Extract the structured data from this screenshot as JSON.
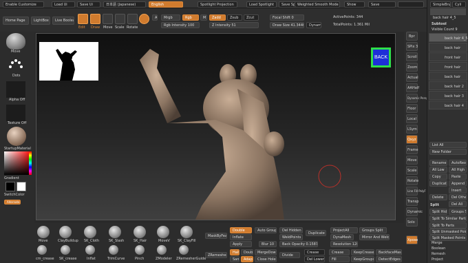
{
  "menu": {
    "enable_customize": "Enable Customize",
    "load_ui": "Load Ui",
    "save_ui": "Save Ui",
    "language_jp": "日本語 (Japanese)",
    "language_en": "English",
    "spotlight_projection": "Spotlight Projection",
    "load_spotlight": "Load Spotlight",
    "save_spotlight": "Save Spotlight",
    "weighted_smooth": "Weighted Smooth Mode 0",
    "show": "Show",
    "save": "Save",
    "simple_brush": "SimpleBrush",
    "cyl": "Cyli"
  },
  "toolbar": {
    "home_page": "Home Page",
    "lightbox": "LightBox",
    "live_boolean": "Live Boolean",
    "edit": "Edit",
    "draw": "Draw",
    "move": "Move",
    "scale": "Scale",
    "rotate": "Rotate",
    "a_label": "A",
    "mrgb": "Mrgb",
    "rgb": "Rgb",
    "m": "M",
    "zadd": "Zadd",
    "zsub": "Zsub",
    "zcut": "Zcut",
    "rgb_intensity": "Rgb Intensity 100",
    "z_intensity": "Z Intensity 51",
    "focal_shift": "Focal Shift 0",
    "draw_size": "Draw Size 41.34402",
    "dynamic": "Dynamic",
    "active_points": "ActivePoints: 344",
    "total_points": "TotalPoints: 1.361 Mil"
  },
  "left_tray": {
    "move_label": "Move",
    "dots_label": "Dots",
    "alpha_off": "Alpha Off",
    "texture_off": "Texture Off",
    "startup_material": "StartupMaterial",
    "gradient": "Gradient",
    "switch_color": "SwitchColor",
    "alternate": "Alternate"
  },
  "canvas": {
    "back_button": "BACK"
  },
  "right_shelf": [
    "Bpr",
    "SPix 3",
    "Scroll",
    "Zoom",
    "Actual",
    "AAHalf",
    "Dynamic Persp",
    "Floor",
    "Local",
    "LSym",
    "Qxyz",
    "Frame",
    "Move",
    "Scale",
    "Rotate",
    "Line Fill PolyF",
    "Transp",
    "Dynamic",
    "Solo",
    "Xpose"
  ],
  "right_tray": {
    "subtool_header": "Subtool",
    "visible_count": "Visible Count 9",
    "current_tool": "back hair 4_5",
    "subtool_items": [
      "back hair 4_5",
      "back hair",
      "front hair",
      "front hair",
      "back hair",
      "back hair 2",
      "back hair 3",
      "back hair 4"
    ],
    "list_all": "List All",
    "new_folder": "New Folder",
    "rename": "Rename",
    "auto_reorder": "AutoReorder",
    "all_low": "All Low",
    "all_high": "All High",
    "copy": "Copy",
    "paste": "Paste",
    "duplicate": "Duplicate",
    "append": "Append",
    "insert": "Insert",
    "delete": "Delete",
    "del_other": "Del Other",
    "del_all": "Del All",
    "split_header": "Split",
    "split_hidden": "Split Hidden",
    "groups_split": "Groups Split",
    "split_similar": "Split To Similar Parts",
    "split_parts": "Split To Parts",
    "split_unmasked": "Split Unmasked Points",
    "split_masked": "Split Masked Points",
    "merge": "Merge",
    "boolean": "Boolean",
    "remesh": "Remesh",
    "project": "Project"
  },
  "bottom_tray": {
    "brushes": [
      "Move",
      "ClayBuildup",
      "SK_Cloth",
      "SK_Slash",
      "SK_Hair",
      "MoveV",
      "SK_ClayFill"
    ],
    "brushes_row2": [
      "cm_crease",
      "SK_crease",
      "Inflat",
      "TrimCurve",
      "Pinch",
      "ZModeler",
      "ZRemesherGuide"
    ],
    "mask_by_feature": "MaskByFeature",
    "double": "Double",
    "auto_groups": "Auto Groups",
    "del_hidden": "Del Hidden",
    "dupliclone": "Duplicate",
    "project_all": "ProjectAll",
    "groups_split": "Groups Split",
    "inflate": "Inflate",
    "weld_points": "WeldPoints",
    "dyna_mesh": "DynaMesh",
    "mirror_weld": "Mirror And Weld",
    "apply": "Apply",
    "blur": "Blur 10",
    "back_opacity": "Back Opacity 0.15873",
    "resolution": "Resolution 128",
    "zremesher": "ZRemesher",
    "half": "Half",
    "double2": "Double",
    "merge_down": "MergeDown",
    "divide": "Divide",
    "crease": "Crease",
    "keep_creases": "KeepCreases",
    "backface_mask": "BackfaceMask",
    "same": "Same",
    "adapt": "Adapt",
    "close_holes": "Close Holes",
    "del_lower": "Del Lower",
    "fill": "Fill",
    "keep_groups": "KeepGroups",
    "detect_edges": "DetectEdges"
  },
  "colors": {
    "accent": "#d07b2e",
    "back_button_bg": "#1d2fd8",
    "back_button_border": "#2fe04a"
  }
}
